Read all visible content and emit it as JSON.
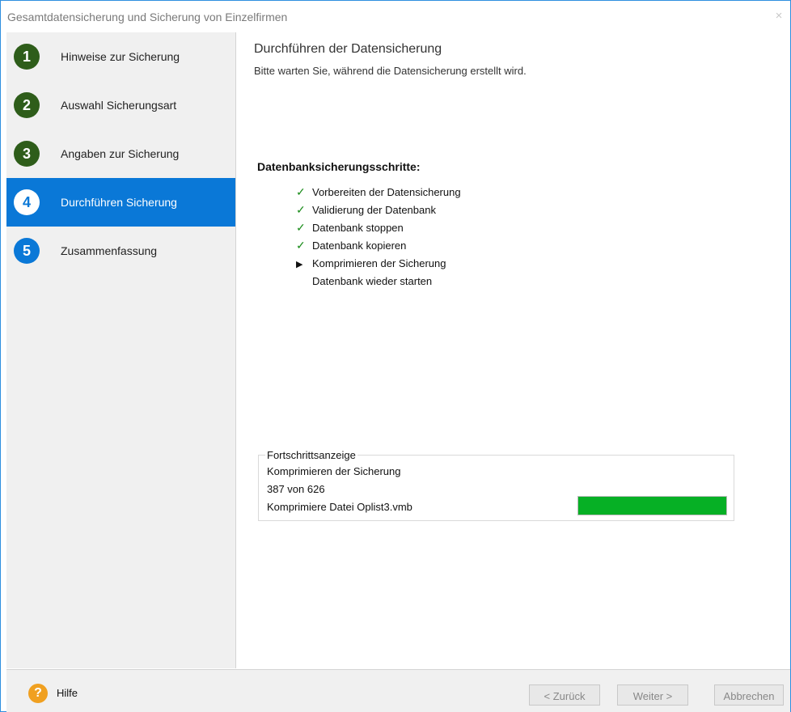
{
  "window": {
    "title": "Gesamtdatensicherung und Sicherung von Einzelfirmen",
    "close_glyph": "×"
  },
  "sidebar": {
    "steps": [
      {
        "number": "1",
        "label": "Hinweise zur Sicherung",
        "state": "done"
      },
      {
        "number": "2",
        "label": "Auswahl Sicherungsart",
        "state": "done"
      },
      {
        "number": "3",
        "label": "Angaben zur Sicherung",
        "state": "done"
      },
      {
        "number": "4",
        "label": "Durchführen Sicherung",
        "state": "current"
      },
      {
        "number": "5",
        "label": "Zusammenfassung",
        "state": "pending"
      }
    ]
  },
  "main": {
    "title": "Durchführen der Datensicherung",
    "subtitle": "Bitte warten Sie, während die Datensicherung erstellt wird.",
    "steps_heading": "Datenbanksicherungsschritte:",
    "process_steps": [
      {
        "label": "Vorbereiten der Datensicherung",
        "status": "done",
        "mark": "✓"
      },
      {
        "label": "Validierung der Datenbank",
        "status": "done",
        "mark": "✓"
      },
      {
        "label": "Datenbank stoppen",
        "status": "done",
        "mark": "✓"
      },
      {
        "label": "Datenbank kopieren",
        "status": "done",
        "mark": "✓"
      },
      {
        "label": "Komprimieren der Sicherung",
        "status": "active",
        "mark": "▶"
      },
      {
        "label": "Datenbank wieder starten",
        "status": "pending",
        "mark": ""
      }
    ]
  },
  "progress": {
    "legend": "Fortschrittsanzeige",
    "phase": "Komprimieren der Sicherung",
    "counter": " 387 von 626",
    "file": "Komprimiere Datei Oplist3.vmb",
    "bar_fraction": 1.0,
    "bar_color": "#06b025"
  },
  "footer": {
    "help_icon": "?",
    "help_label": "Hilfe",
    "back_label": "< Zurück",
    "next_label": "Weiter >",
    "cancel_label": "Abbrechen"
  },
  "colors": {
    "accent": "#0a78d7",
    "done_step": "#2e5d1a",
    "check": "#1a8c1a",
    "help": "#f0a020"
  }
}
